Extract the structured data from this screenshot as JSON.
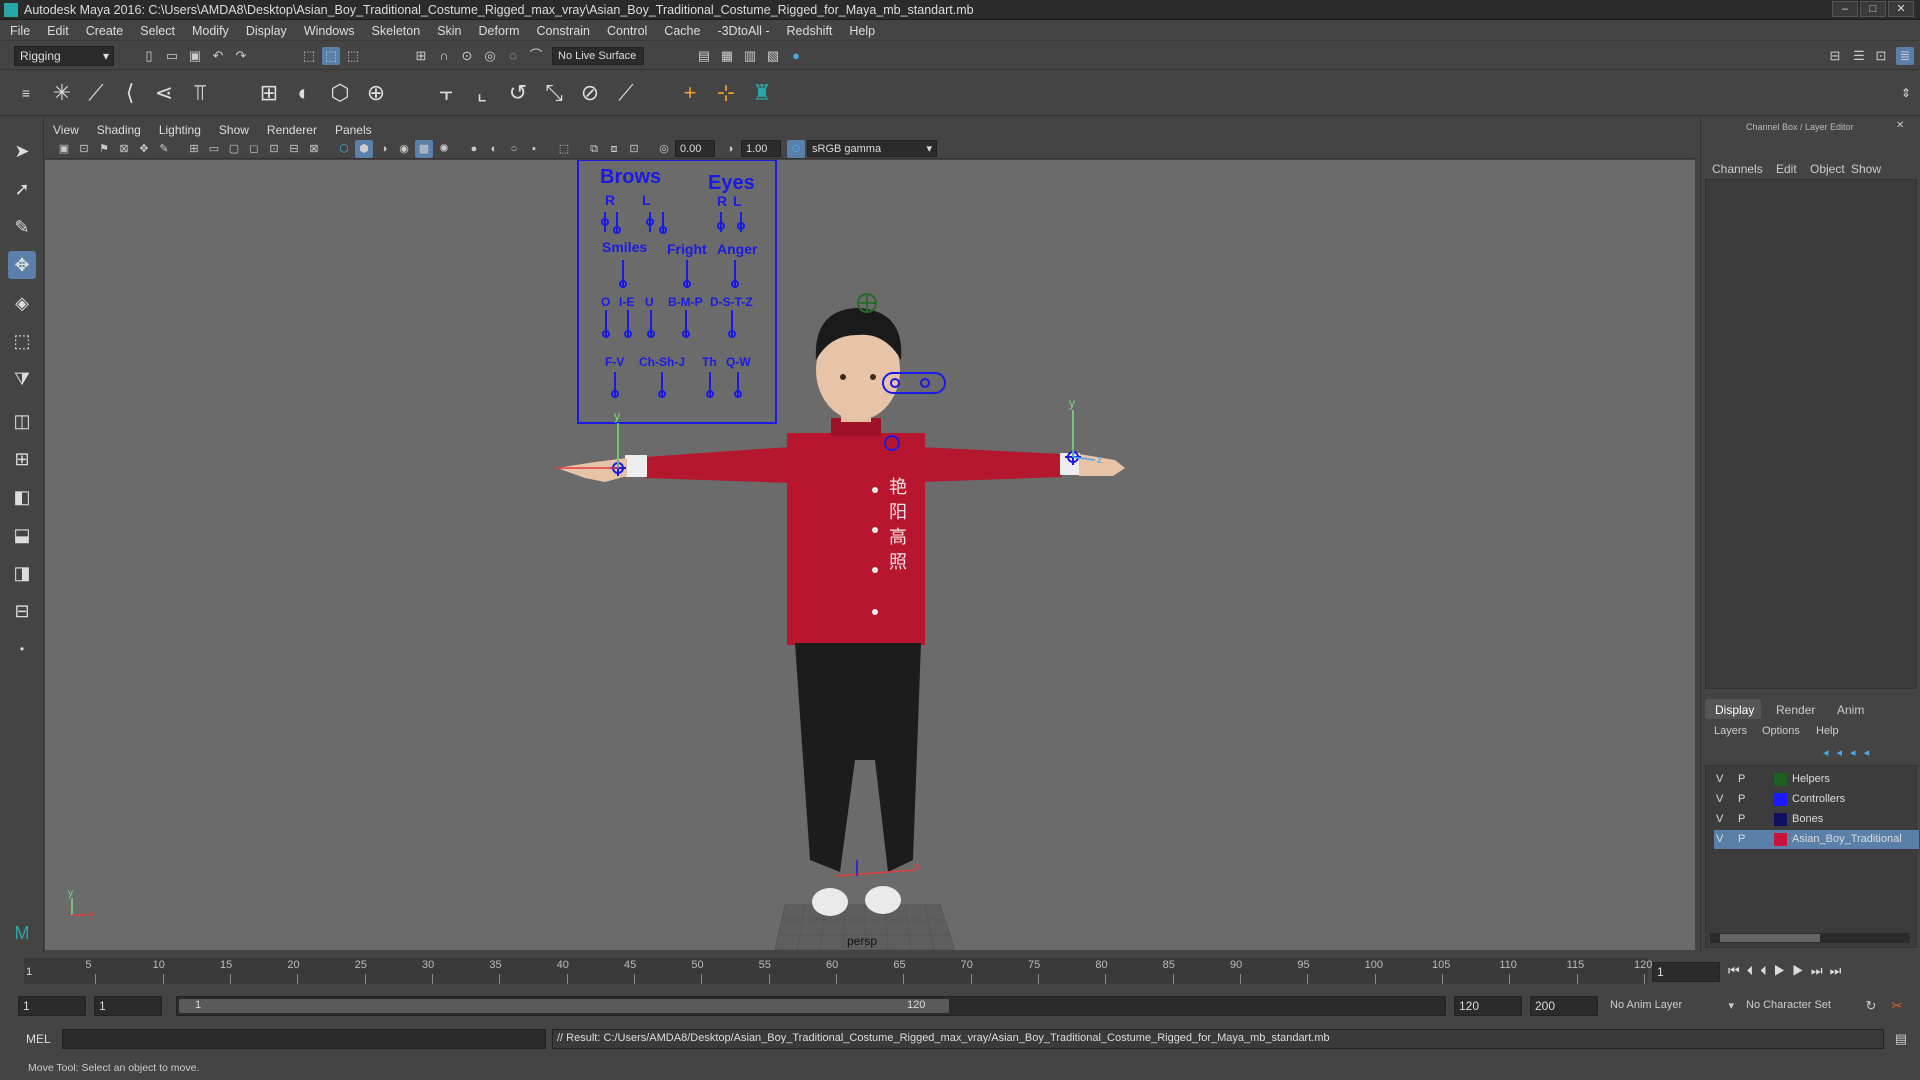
{
  "window": {
    "title": "Autodesk Maya 2016: C:\\Users\\AMDA8\\Desktop\\Asian_Boy_Traditional_Costume_Rigged_max_vray\\Asian_Boy_Traditional_Costume_Rigged_for_Maya_mb_standart.mb",
    "min": "–",
    "max": "□",
    "close": "✕"
  },
  "menu": [
    "File",
    "Edit",
    "Create",
    "Select",
    "Modify",
    "Display",
    "Windows",
    "Skeleton",
    "Skin",
    "Deform",
    "Constrain",
    "Control",
    "Cache",
    "-3DtoAll -",
    "Redshift",
    "Help"
  ],
  "statusline": {
    "mode": "Rigging",
    "live_surface": "No Live Surface"
  },
  "viewport_menu": [
    "View",
    "Shading",
    "Lighting",
    "Show",
    "Renderer",
    "Panels"
  ],
  "viewport_toolbar": {
    "exposure": "0.00",
    "gamma": "1.00",
    "colorspace": "sRGB gamma"
  },
  "viewport": {
    "camera_label": "persp",
    "axis_y": "y",
    "axis_x": "x",
    "axis_z": "z"
  },
  "face_ui": {
    "brows": "Brows",
    "eyes": "Eyes",
    "r": "R",
    "l": "L",
    "smiles": "Smiles",
    "fright": "Fright",
    "anger": "Anger",
    "row3": [
      "O",
      "I-E",
      "U",
      "B-M-P",
      "D-S-T-Z"
    ],
    "row4": [
      "F-V",
      "Ch-Sh-J",
      "Th",
      "Q-W"
    ]
  },
  "shirt_chars": [
    "艳",
    "阳",
    "高",
    "照"
  ],
  "right_panel": {
    "title": "Channel Box / Layer Editor",
    "menus": [
      "Channels",
      "Edit",
      "Object",
      "Show"
    ],
    "tabs": [
      "Display",
      "Render",
      "Anim"
    ],
    "layer_menus": [
      "Layers",
      "Options",
      "Help"
    ],
    "layers": [
      {
        "v": "V",
        "p": "P",
        "name": "Helpers",
        "color": "#1f5f1f"
      },
      {
        "v": "V",
        "p": "P",
        "name": "Controllers",
        "color": "#1a1aff"
      },
      {
        "v": "V",
        "p": "P",
        "name": "Bones",
        "color": "#101060"
      },
      {
        "v": "V",
        "p": "P",
        "name": "Asian_Boy_Traditional",
        "color": "#c8143c"
      }
    ]
  },
  "timeline": {
    "ticks": [
      "5",
      "10",
      "15",
      "20",
      "25",
      "30",
      "35",
      "40",
      "45",
      "50",
      "55",
      "60",
      "65",
      "70",
      "75",
      "80",
      "85",
      "90",
      "95",
      "100",
      "105",
      "110",
      "115",
      "120"
    ],
    "start_marker": "1",
    "current_frame": "1"
  },
  "range": {
    "start": "1",
    "start2": "1",
    "slider_start": "1",
    "slider_end": "120",
    "end": "120",
    "end2": "200",
    "anim_layer": "No Anim Layer",
    "char_set": "No Character Set"
  },
  "cmdline": {
    "lang": "MEL",
    "result": "// Result: C:/Users/AMDA8/Desktop/Asian_Boy_Traditional_Costume_Rigged_max_vray/Asian_Boy_Traditional_Costume_Rigged_for_Maya_mb_standart.mb"
  },
  "help": "Move Tool: Select an object to move."
}
